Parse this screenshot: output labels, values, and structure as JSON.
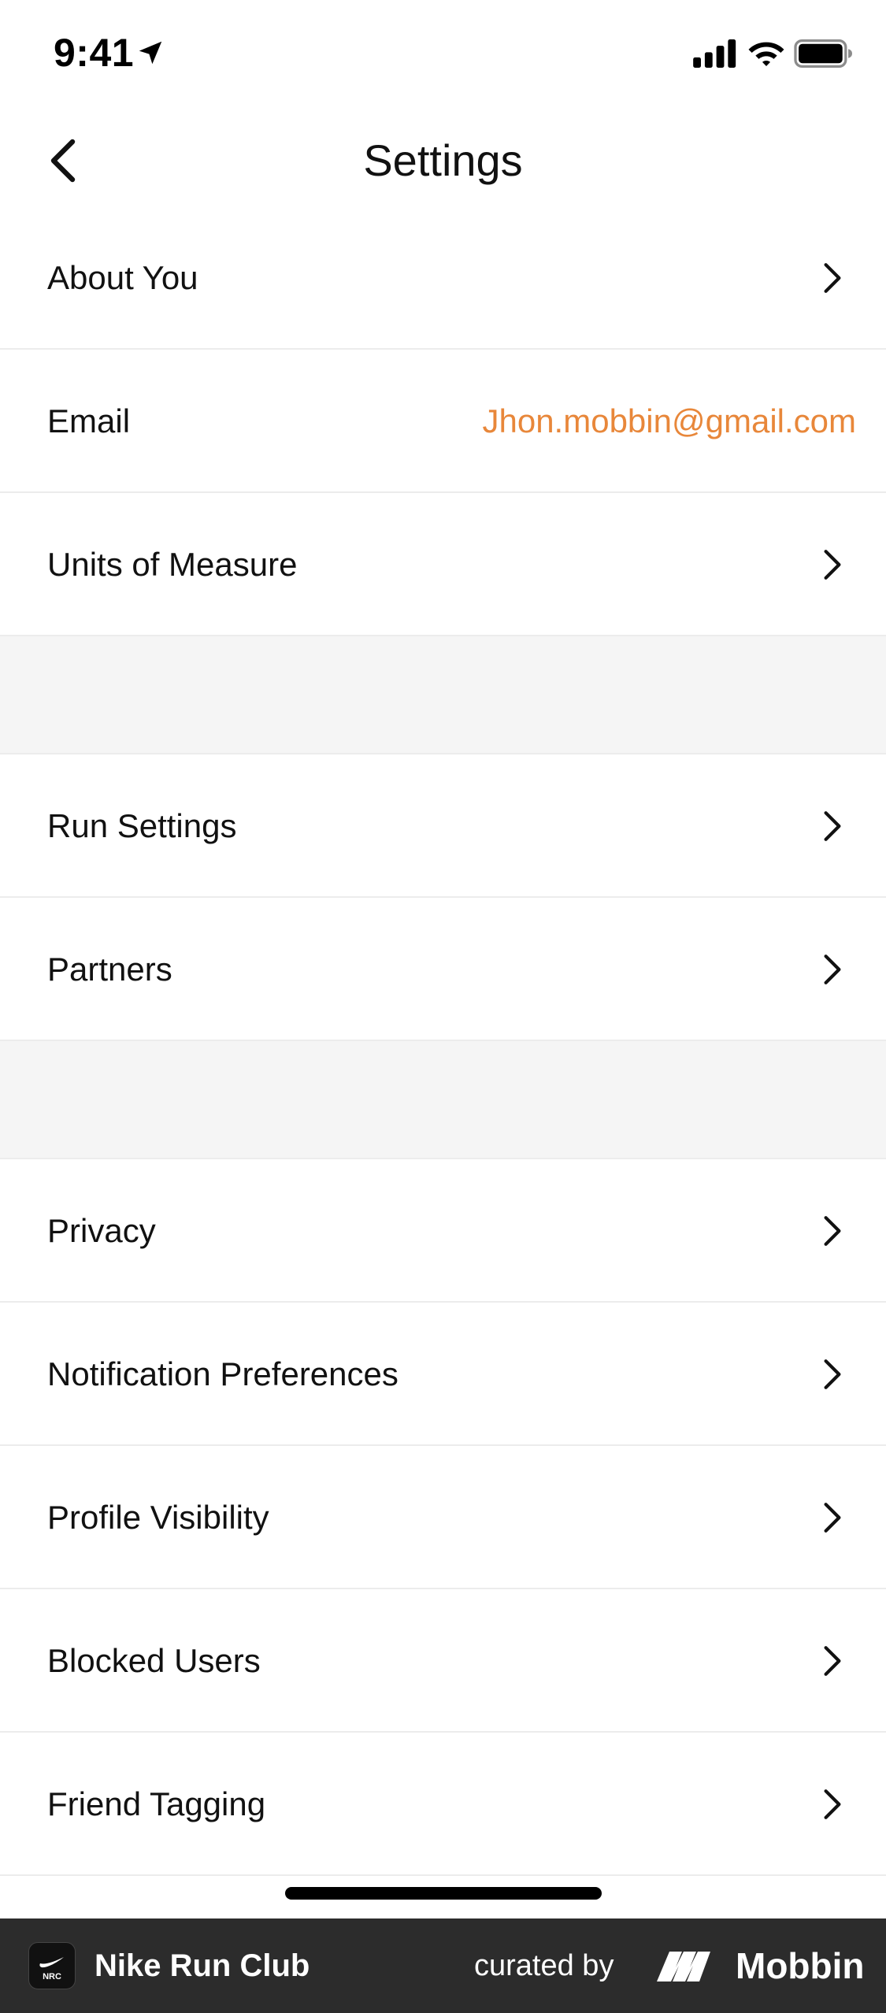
{
  "status_bar": {
    "time": "9:41",
    "icons": [
      "location-arrow-icon",
      "cellular-signal-icon",
      "wifi-icon",
      "battery-icon"
    ]
  },
  "nav": {
    "title": "Settings",
    "back_icon": "chevron-left-icon"
  },
  "sections": [
    {
      "rows": [
        {
          "label": "About You",
          "type": "link"
        },
        {
          "label": "Email",
          "type": "value",
          "value": "Jhon.mobbin@gmail.com"
        },
        {
          "label": "Units of Measure",
          "type": "link"
        }
      ]
    },
    {
      "rows": [
        {
          "label": "Run Settings",
          "type": "link"
        },
        {
          "label": "Partners",
          "type": "link"
        }
      ]
    },
    {
      "rows": [
        {
          "label": "Privacy",
          "type": "link"
        },
        {
          "label": "Notification Preferences",
          "type": "link"
        },
        {
          "label": "Profile Visibility",
          "type": "link"
        },
        {
          "label": "Blocked Users",
          "type": "link"
        },
        {
          "label": "Friend Tagging",
          "type": "link"
        }
      ]
    }
  ],
  "footer": {
    "app_name": "Nike Run Club",
    "curated_by": "curated by",
    "brand": "Mobbin",
    "app_logo_text": "NRC"
  },
  "colors": {
    "accent": "#e8873a",
    "separator": "#ececec",
    "section_gap": "#f5f5f5",
    "footer_bg": "#2c2c2c"
  }
}
